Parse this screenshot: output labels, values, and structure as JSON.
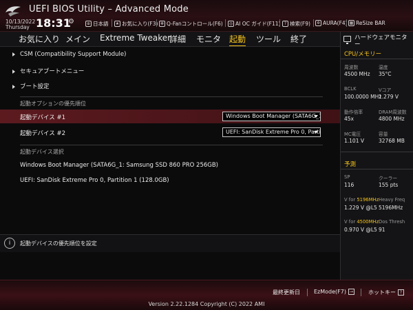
{
  "header": {
    "title": "UEFI BIOS Utility – Advanced Mode",
    "date": "10/13/2022",
    "weekday": "Thursday",
    "time": "18:31",
    "toolbar": [
      {
        "icon": "globe-icon",
        "label": "日本語"
      },
      {
        "icon": "star-icon",
        "label": "お気に入り(F3)"
      },
      {
        "icon": "fan-icon",
        "label": "Q-Fanコントロール(F6)"
      },
      {
        "icon": "ai-icon",
        "label": "AI OC ガイド(F11)"
      },
      {
        "icon": "question-icon",
        "label": "検索(F9)"
      },
      {
        "icon": "aura-icon",
        "label": "AURA(F4)"
      },
      {
        "icon": "resize-bar-icon",
        "label": "ReSize BAR"
      }
    ]
  },
  "menu": {
    "tabs": [
      "お気に入り",
      "メイン",
      "Extreme Tweaker",
      "詳細",
      "モニタ",
      "起動",
      "ツール",
      "終了"
    ],
    "active": "起動"
  },
  "main": {
    "sections": [
      "CSM (Compatibility Support Module)",
      "セキュアブートメニュー",
      "ブート設定"
    ],
    "priority_header": "起動オプションの優先順位",
    "boot_options": [
      {
        "label": "起動デバイス #1",
        "value": "Windows Boot Manager (SATA6G_1: Samsung SSD 860 PRO 256GB)"
      },
      {
        "label": "起動デバイス #2",
        "value": "UEFI: SanDisk Extreme Pro 0, Partition 1 (128.0GB)"
      }
    ],
    "device_select_header": "起動デバイス選択",
    "devices": [
      "Windows Boot Manager (SATA6G_1: Samsung SSD 860 PRO 256GB)",
      "UEFI: SanDisk Extreme Pro 0, Partition 1 (128.0GB)"
    ]
  },
  "help": {
    "text": "起動デバイスの優先順位を設定"
  },
  "monitor": {
    "title": "ハードウェアモニター",
    "cpu_section": "CPU/メモリー",
    "cpu": {
      "freq_label": "周波数",
      "freq_value": "4500 MHz",
      "temp_label": "温度",
      "temp_value": "35°C",
      "bclk_label": "BCLK",
      "bclk_value": "100.0000 MHz",
      "vcore_label": "Vコア",
      "vcore_value": "1.279 V",
      "ratio_label": "動作倍率",
      "ratio_value": "45x",
      "dram_label": "DRAM周波数",
      "dram_value": "4800 MHz",
      "mc_label": "MC電圧",
      "mc_value": "1.101 V",
      "cap_label": "容量",
      "cap_value": "32768 MB"
    },
    "predict_section": "予測",
    "predict": {
      "sp_label": "SP",
      "sp_value": "116",
      "cooler_label": "クーラー",
      "cooler_value": "155 pts",
      "v1_prefix": "V for ",
      "v1_freq": "5196MHz",
      "v1_right_label": "Heavy Freq",
      "v1_value": "1.229 V @L5",
      "v1_right_value": "5196MHz",
      "v2_prefix": "V for ",
      "v2_freq": "4500MHz",
      "v2_right_label": "Dos Thresh",
      "v2_value": "0.970 V @L5",
      "v2_right_value": "91"
    }
  },
  "footer": {
    "last_change": "最終更新日",
    "ezmode": "EzMode(F7)",
    "hotkey": "ホットキー",
    "version": "Version 2.22.1284 Copyright (C) 2022 AMI"
  },
  "colors": {
    "accent": "#f4c21a",
    "selection": "#5c1a1f",
    "header_red": "#2a0f13"
  }
}
